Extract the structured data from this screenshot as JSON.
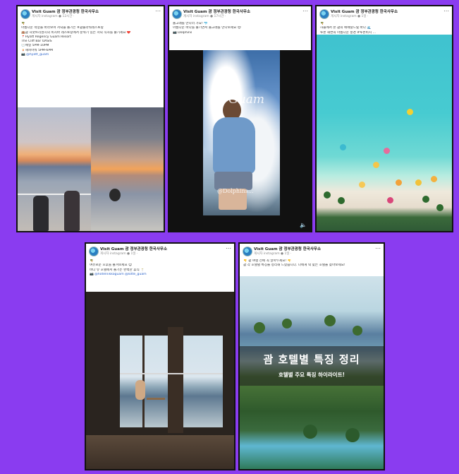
{
  "page": {
    "background": "#8a3cf0"
  },
  "cards": [
    {
      "id": "card1",
      "header": {
        "name": "Visit Guam 괌 정부관광청 한국사무소",
        "sub": "게시자 instagram ● 12시간 ·"
      },
      "lines": [
        "🌴",
        "아름다운 석양을 바라보며 저녁을 즐기는 #괌플라워레스토랑",
        "🏨괌 하얏트리젠시의 비치바 레스토랑에서 분위기 있는 저녁 식사를 즐기세요 ❤️",
        "📍Hyatt Regency Guam Resort",
        "The Cliff Bar OASIS",
        "🕐매일 5PM-10PM",
        "🍹해피아워 5PM-6PM",
        "📷 @hyatt_guam"
      ]
    },
    {
      "id": "card2",
      "header": {
        "name": "Visit Guam 괌 정부관광청 한국사무소",
        "sub": "게시자 instagram ● 17시간 ·"
      },
      "lines": [
        "돌고래를 만나러 가요! 🐬",
        "아름다운 바다를 즐기면서 돌고래를 만나보세요 😍",
        "📷 Dolphins"
      ],
      "watermark_top": "#Guam",
      "watermark_bottom": "@Dolphins..."
    },
    {
      "id": "card3",
      "header": {
        "name": "Visit Guam 괌 정부관광청 한국사무소",
        "sub": "게시자 instagram ● 1일 ·"
      },
      "lines": [
        "🌴",
        "하늘에서 본 괌의 에메랄드빛 바다 🌊",
        "투몬 해변의 아름다운 풍경 #투몬비치 ..."
      ]
    },
    {
      "id": "card4",
      "header": {
        "name": "Visit Guam 괌 정부관광청 한국사무소",
        "sub": "게시자 instagram ● 1일 ·"
      },
      "lines": [
        "🌴",
        "여유로운 오후를 즐겨보세요 😊",
        "바다 뷰 호텔에서 즐기는 완벽한 휴식 🍸",
        "📷 @hotelnikkoguam @lotte_guam"
      ]
    },
    {
      "id": "card5",
      "header": {
        "name": "Visit Guam 괌 정부관광청 한국사무소",
        "sub": "게시자 instagram ● 1일 ·"
      },
      "lines": [
        "👇 괌 여행 전에 꼭 알아두세요! 👇",
        "괌 각 호텔별 특징을 정리해 드렸습니다. 나에게 딱 맞는 호텔을 찾아보세요!"
      ],
      "banner_title": "괌 호텔별 특징 정리",
      "banner_sub": "호텔별 주요 특징 하이라이트!"
    }
  ]
}
